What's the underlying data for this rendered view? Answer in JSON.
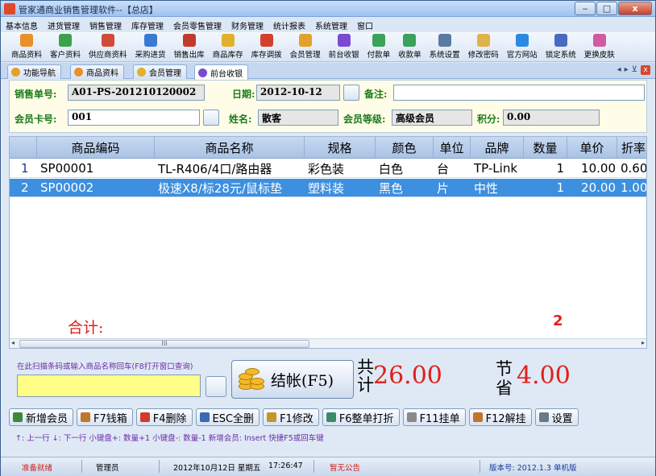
{
  "window": {
    "title": "管家通商业销售管理软件--【总店】",
    "min": "‒",
    "max": "□",
    "close": "x"
  },
  "menu": [
    "基本信息",
    "进货管理",
    "销售管理",
    "库存管理",
    "会员零售管理",
    "财务管理",
    "统计报表",
    "系统管理",
    "窗口"
  ],
  "toolbar": [
    {
      "label": "商品资料",
      "color": "#e8902a"
    },
    {
      "label": "客户资料",
      "color": "#3aa24a"
    },
    {
      "label": "供应商资料",
      "color": "#d24a3a"
    },
    {
      "label": "采购进货",
      "color": "#3a7ad2"
    },
    {
      "label": "销售出库",
      "color": "#c23a2a"
    },
    {
      "label": "商品库存",
      "color": "#e2b02a"
    },
    {
      "label": "库存调拨",
      "color": "#d2402a"
    },
    {
      "label": "会员管理",
      "color": "#e2a22a"
    },
    {
      "label": "前台收银",
      "color": "#7a4ad2"
    },
    {
      "label": "付款单",
      "color": "#3aa25a"
    },
    {
      "label": "收款单",
      "color": "#3aa25a"
    },
    {
      "label": "系统设置",
      "color": "#5a7aa2"
    },
    {
      "label": "修改密码",
      "color": "#e2b24a"
    },
    {
      "label": "官方网站",
      "color": "#2a8ae2"
    },
    {
      "label": "锁定系统",
      "color": "#4a6ac2"
    },
    {
      "label": "更换皮肤",
      "color": "#d25aa2"
    }
  ],
  "tabs": [
    {
      "label": "功能导航",
      "color": "#e2a22a"
    },
    {
      "label": "商品资料",
      "color": "#e8902a"
    },
    {
      "label": "会员管理",
      "color": "#e2b02a"
    },
    {
      "label": "前台收银",
      "color": "#7a4ad2"
    }
  ],
  "tabnav": {
    "prev": "◂",
    "next": "▸",
    "pin": "⊻",
    "close": "x"
  },
  "form": {
    "order_no_label": "销售单号:",
    "order_no": "A01-PS-201210120002",
    "date_label": "日期:",
    "date": "2012-10-12",
    "remark_label": "备注:",
    "remark": "",
    "card_label": "会员卡号:",
    "card": "001",
    "name_label": "姓名:",
    "name": "散客",
    "level_label": "会员等级:",
    "level": "高级会员",
    "points_label": "积分:",
    "points": "0.00"
  },
  "grid": {
    "columns": [
      "商品编码",
      "商品名称",
      "规格",
      "颜色",
      "单位",
      "品牌",
      "数量",
      "单价",
      "折率"
    ],
    "rows": [
      {
        "no": "1",
        "code": "SP00001",
        "name": "TL-R406/4口/路由器",
        "spec": "彩色装",
        "color": "白色",
        "unit": "台",
        "brand": "TP-Link",
        "qty": "1",
        "price": "10.00",
        "rate": "0.60"
      },
      {
        "no": "2",
        "code": "SP00002",
        "name": "极速X8/标28元/鼠标垫",
        "spec": "塑料装",
        "color": "黑色",
        "unit": "片",
        "brand": "中性",
        "qty": "1",
        "price": "20.00",
        "rate": "1.00"
      }
    ],
    "total_label": "合计:",
    "total_qty": "2",
    "scroll_thumb": "III"
  },
  "scan": {
    "hint": "在此扫描条码或输入商品名称回车(F8打开窗口查询)",
    "value": "",
    "checkout_label": "结帐(F5)",
    "total_label_1": "共",
    "total_label_2": "计",
    "total_value": "26.00",
    "save_label_1": "节",
    "save_label_2": "省",
    "save_value": "4.00"
  },
  "fkeys": [
    {
      "label": "新增会员",
      "color": "#3a8a3a"
    },
    {
      "label": "F7钱箱",
      "color": "#c2762a"
    },
    {
      "label": "F4删除",
      "color": "#d23a2a"
    },
    {
      "label": "ESC全删",
      "color": "#3a6ab2"
    },
    {
      "label": "F1修改",
      "color": "#c2962a"
    },
    {
      "label": "F6整单打折",
      "color": "#3a8a6a"
    },
    {
      "label": "F11挂单",
      "color": "#8a8a8a"
    },
    {
      "label": "F12解挂",
      "color": "#c2762a"
    },
    {
      "label": "设置",
      "color": "#6a7a8a"
    }
  ],
  "hint": "↑: 上一行    ↓: 下一行    小键盘+: 数量+1    小键盘-: 数量-1    新增会员: Insert    快捷F5或回车键",
  "status": {
    "ready": "准备就绪",
    "user": "管理员",
    "datetime": "2012年10月12日 星期五",
    "time": "17:26:47",
    "notice": "暂无公告",
    "version": "版本号: 2012.1.3 单机版"
  }
}
